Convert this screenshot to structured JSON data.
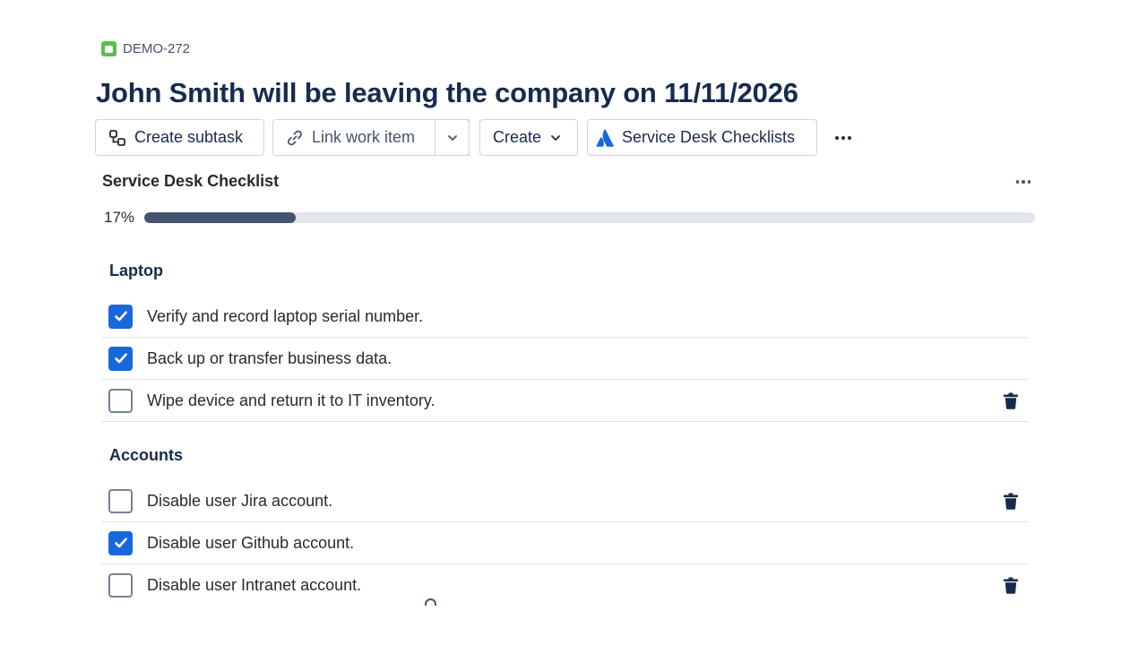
{
  "issue": {
    "key": "DEMO-272",
    "title": "John Smith will be leaving the company on 11/11/2026"
  },
  "toolbar": {
    "create_subtask": "Create subtask",
    "link_work_item": "Link work item",
    "create": "Create",
    "service_desk_checklists": "Service Desk Checklists"
  },
  "checklist": {
    "title": "Service Desk Checklist",
    "progress_label": "17%",
    "progress_percent": 17,
    "sections": [
      {
        "name": "Laptop",
        "items": [
          {
            "text": "Verify and record laptop serial number.",
            "checked": true,
            "show_delete": false
          },
          {
            "text": "Back up or transfer business data.",
            "checked": true,
            "show_delete": false
          },
          {
            "text": "Wipe device and return it to IT inventory.",
            "checked": false,
            "show_delete": true
          }
        ]
      },
      {
        "name": "Accounts",
        "items": [
          {
            "text": "Disable user Jira account.",
            "checked": false,
            "show_delete": true
          },
          {
            "text": "Disable user Github account.",
            "checked": true,
            "show_delete": false
          },
          {
            "text": "Disable user Intranet account.",
            "checked": false,
            "show_delete": true
          }
        ]
      }
    ]
  },
  "colors": {
    "checkbox_checked": "#1868db",
    "progress_fill": "#44546f",
    "progress_track": "#e2e5ea",
    "work_type_icon": "#5bbd4a",
    "atlassian_logo": "#1868db"
  },
  "icons": {
    "work_type": "story-icon",
    "subtask": "subtask-icon",
    "link": "link-icon",
    "chevron": "chevron-down-icon",
    "app": "atlassian-logo-icon",
    "more": "more-icon",
    "delete": "trash-icon",
    "check": "checkmark-icon"
  }
}
